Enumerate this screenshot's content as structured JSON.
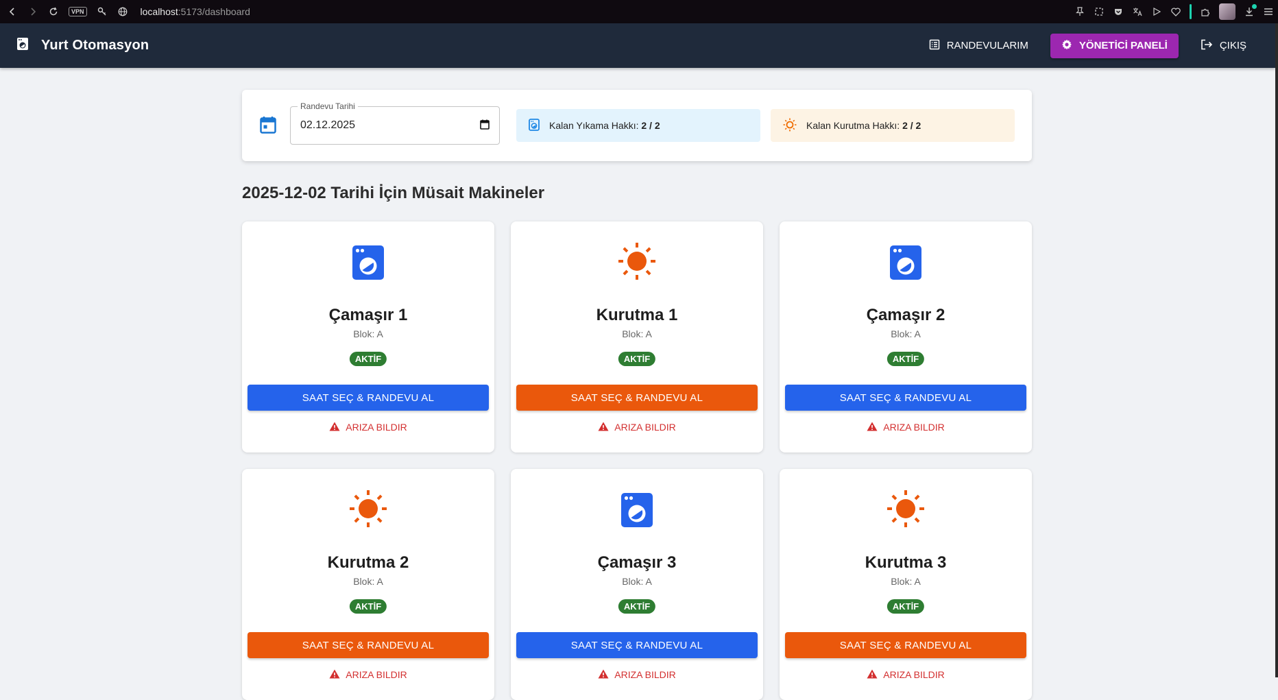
{
  "browser": {
    "url_host": "localhost",
    "url_path": ":5173/dashboard",
    "vpn_label": "VPN"
  },
  "app": {
    "title": "Yurt Otomasyon",
    "nav": {
      "appointments": "RANDEVULARIM",
      "admin_panel": "YÖNETİCİ PANELİ",
      "logout": "ÇIKIŞ"
    }
  },
  "filter": {
    "date_label": "Randevu Tarihi",
    "date_value": "02.12.2025",
    "wash_quota_label": "Kalan Yıkama Hakkı:",
    "wash_quota_value": "2 / 2",
    "dry_quota_label": "Kalan Kurutma Hakkı:",
    "dry_quota_value": "2 / 2"
  },
  "section_title": "2025-12-02 Tarihi İçin Müsait Makineler",
  "machines": [
    {
      "name": "Çamaşır 1",
      "block": "Blok: A",
      "status": "AKTİF",
      "type": "washer",
      "book_label": "SAAT SEÇ & RANDEVU AL",
      "report_label": "ARIZA BILDIR"
    },
    {
      "name": "Kurutma 1",
      "block": "Blok: A",
      "status": "AKTİF",
      "type": "dryer",
      "book_label": "SAAT SEÇ & RANDEVU AL",
      "report_label": "ARIZA BILDIR"
    },
    {
      "name": "Çamaşır 2",
      "block": "Blok: A",
      "status": "AKTİF",
      "type": "washer",
      "book_label": "SAAT SEÇ & RANDEVU AL",
      "report_label": "ARIZA BILDIR"
    },
    {
      "name": "Kurutma 2",
      "block": "Blok: A",
      "status": "AKTİF",
      "type": "dryer",
      "book_label": "SAAT SEÇ & RANDEVU AL",
      "report_label": "ARIZA BILDIR"
    },
    {
      "name": "Çamaşır 3",
      "block": "Blok: A",
      "status": "AKTİF",
      "type": "washer",
      "book_label": "SAAT SEÇ & RANDEVU AL",
      "report_label": "ARIZA BILDIR"
    },
    {
      "name": "Kurutma 3",
      "block": "Blok: A",
      "status": "AKTİF",
      "type": "dryer",
      "book_label": "SAAT SEÇ & RANDEVU AL",
      "report_label": "ARIZA BILDIR"
    }
  ],
  "colors": {
    "appbar": "#1f2a3b",
    "admin": "#9c27b0",
    "washer": "#2563eb",
    "dryer": "#ea580c",
    "active": "#2e7d32",
    "report": "#d32f2f"
  },
  "icons": {
    "washer": "washing-machine-icon",
    "dryer": "sun-icon",
    "calendar": "calendar-icon",
    "report": "warning-icon"
  }
}
